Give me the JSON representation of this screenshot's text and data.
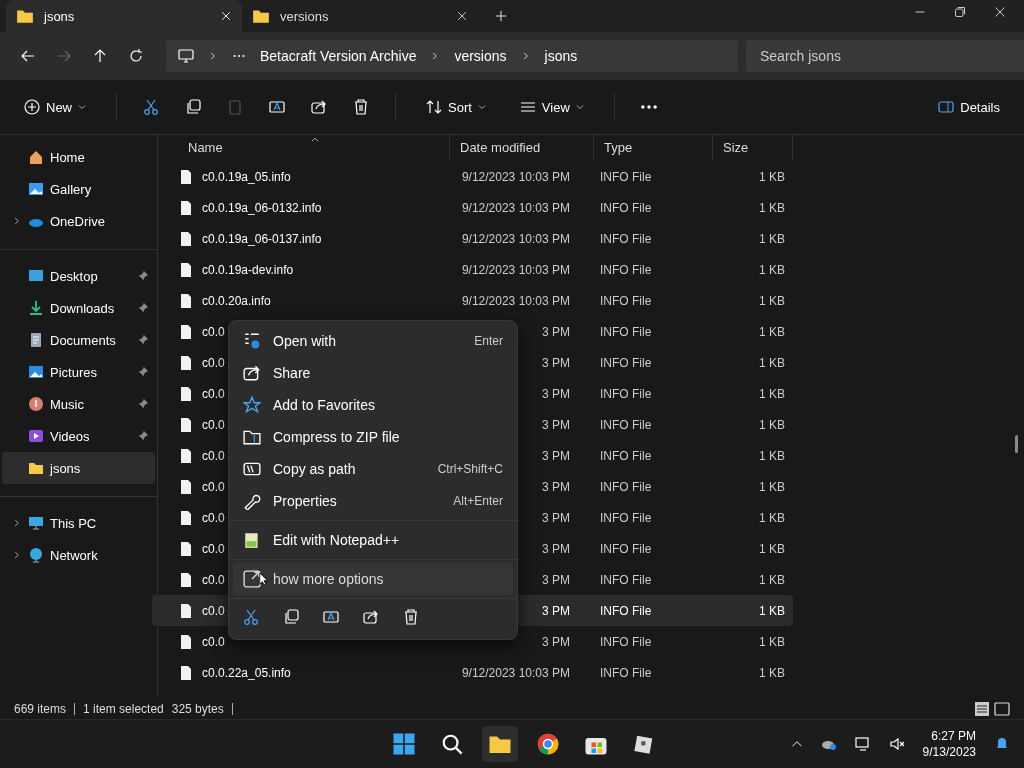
{
  "tabs": [
    {
      "label": "jsons",
      "selected": true
    },
    {
      "label": "versions",
      "selected": false
    }
  ],
  "address": {
    "crumbs": [
      "Betacraft Version Archive",
      "versions",
      "jsons"
    ]
  },
  "search": {
    "placeholder": "Search jsons"
  },
  "toolbar": {
    "new": "New",
    "sort": "Sort",
    "view": "View",
    "details": "Details"
  },
  "sidebar": {
    "groups": [
      [
        {
          "label": "Home",
          "selected": false,
          "pinned": false,
          "expandable": false
        },
        {
          "label": "Gallery",
          "selected": false,
          "pinned": false,
          "expandable": false
        },
        {
          "label": "OneDrive",
          "selected": false,
          "pinned": false,
          "expandable": true
        }
      ],
      [
        {
          "label": "Desktop",
          "selected": false,
          "pinned": true,
          "expandable": false
        },
        {
          "label": "Downloads",
          "selected": false,
          "pinned": true,
          "expandable": false
        },
        {
          "label": "Documents",
          "selected": false,
          "pinned": true,
          "expandable": false
        },
        {
          "label": "Pictures",
          "selected": false,
          "pinned": true,
          "expandable": false
        },
        {
          "label": "Music",
          "selected": false,
          "pinned": true,
          "expandable": false
        },
        {
          "label": "Videos",
          "selected": false,
          "pinned": true,
          "expandable": false
        },
        {
          "label": "jsons",
          "selected": true,
          "pinned": false,
          "expandable": false
        }
      ],
      [
        {
          "label": "This PC",
          "selected": false,
          "pinned": false,
          "expandable": true
        },
        {
          "label": "Network",
          "selected": false,
          "pinned": false,
          "expandable": true
        }
      ]
    ]
  },
  "table": {
    "columns": [
      "Name",
      "Date modified",
      "Type",
      "Size"
    ],
    "rows": [
      {
        "name": "c0.0.19a_05.info",
        "date": "9/12/2023 10:03 PM",
        "type": "INFO File",
        "size": "1 KB",
        "selected": false
      },
      {
        "name": "c0.0.19a_06-0132.info",
        "date": "9/12/2023 10:03 PM",
        "type": "INFO File",
        "size": "1 KB",
        "selected": false
      },
      {
        "name": "c0.0.19a_06-0137.info",
        "date": "9/12/2023 10:03 PM",
        "type": "INFO File",
        "size": "1 KB",
        "selected": false
      },
      {
        "name": "c0.0.19a-dev.info",
        "date": "9/12/2023 10:03 PM",
        "type": "INFO File",
        "size": "1 KB",
        "selected": false
      },
      {
        "name": "c0.0.20a.info",
        "date": "9/12/2023 10:03 PM",
        "type": "INFO File",
        "size": "1 KB",
        "selected": false
      },
      {
        "name": "c0.0",
        "date": "3 PM",
        "type": "INFO File",
        "size": "1 KB",
        "selected": false
      },
      {
        "name": "c0.0",
        "date": "3 PM",
        "type": "INFO File",
        "size": "1 KB",
        "selected": false
      },
      {
        "name": "c0.0",
        "date": "3 PM",
        "type": "INFO File",
        "size": "1 KB",
        "selected": false
      },
      {
        "name": "c0.0",
        "date": "3 PM",
        "type": "INFO File",
        "size": "1 KB",
        "selected": false
      },
      {
        "name": "c0.0",
        "date": "3 PM",
        "type": "INFO File",
        "size": "1 KB",
        "selected": false
      },
      {
        "name": "c0.0",
        "date": "3 PM",
        "type": "INFO File",
        "size": "1 KB",
        "selected": false
      },
      {
        "name": "c0.0",
        "date": "3 PM",
        "type": "INFO File",
        "size": "1 KB",
        "selected": false
      },
      {
        "name": "c0.0",
        "date": "3 PM",
        "type": "INFO File",
        "size": "1 KB",
        "selected": false
      },
      {
        "name": "c0.0",
        "date": "3 PM",
        "type": "INFO File",
        "size": "1 KB",
        "selected": false
      },
      {
        "name": "c0.0",
        "date": "3 PM",
        "type": "INFO File",
        "size": "1 KB",
        "selected": true
      },
      {
        "name": "c0.0",
        "date": "3 PM",
        "type": "INFO File",
        "size": "1 KB",
        "selected": false
      },
      {
        "name": "c0.0.22a_05.info",
        "date": "9/12/2023 10:03 PM",
        "type": "INFO File",
        "size": "1 KB",
        "selected": false
      }
    ]
  },
  "context_menu": {
    "sections": [
      [
        {
          "label": "Open with",
          "shortcut": "Enter",
          "highlighted": false
        },
        {
          "label": "Share",
          "highlighted": false
        },
        {
          "label": "Add to Favorites",
          "highlighted": false
        },
        {
          "label": "Compress to ZIP file",
          "highlighted": false
        },
        {
          "label": "Copy as path",
          "shortcut": "Ctrl+Shift+C",
          "highlighted": false
        },
        {
          "label": "Properties",
          "shortcut": "Alt+Enter",
          "highlighted": false
        }
      ],
      [
        {
          "label": "Edit with Notepad++",
          "highlighted": false
        }
      ],
      [
        {
          "label": "how more options",
          "highlighted": true
        }
      ]
    ]
  },
  "status_bar": {
    "items": "669 items",
    "selected": "1 item selected",
    "size": "325 bytes"
  },
  "taskbar": {
    "time": "6:27 PM",
    "date": "9/13/2023"
  }
}
